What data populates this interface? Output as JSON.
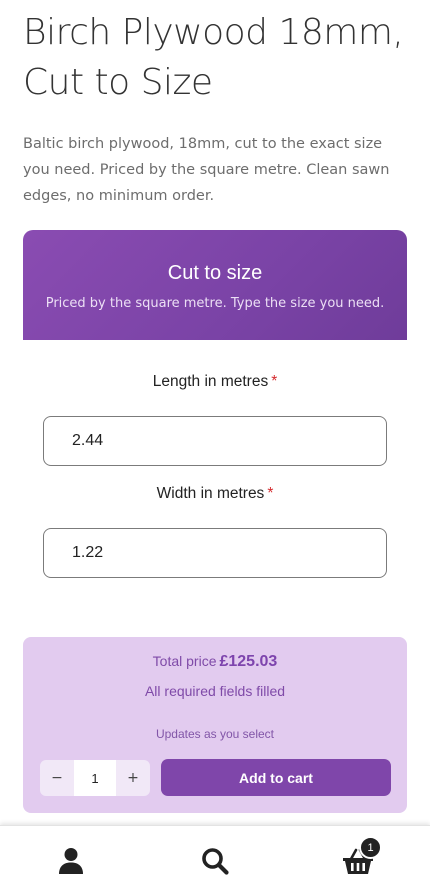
{
  "product": {
    "title": "Birch Plywood 18mm, Cut to Size",
    "description": "Baltic birch plywood, 18mm, cut to the exact size you need. Priced by the square metre. Clean sawn edges, no minimum order."
  },
  "configurator": {
    "title": "Cut to size",
    "subtitle": "Priced by the square metre. Type the size you need.",
    "fields": [
      {
        "label": "Length in metres",
        "required_mark": "*",
        "value": "2.44"
      },
      {
        "label": "Width in metres",
        "required_mark": "*",
        "value": "1.22"
      }
    ]
  },
  "summary": {
    "total_label": "Total price",
    "total_value": "£125.03",
    "status": "All required fields filled",
    "updates_note": "Updates as you select",
    "quantity": "1",
    "decrement_label": "−",
    "increment_label": "+",
    "add_to_cart_label": "Add to cart"
  },
  "bottom_nav": {
    "items": [
      {
        "icon": "account-icon"
      },
      {
        "icon": "search-icon"
      },
      {
        "icon": "basket-icon",
        "badge": "1"
      }
    ]
  },
  "colors": {
    "accent": "#7f46aa",
    "summary_bg": "#e2cbef",
    "required": "#d4282c"
  }
}
